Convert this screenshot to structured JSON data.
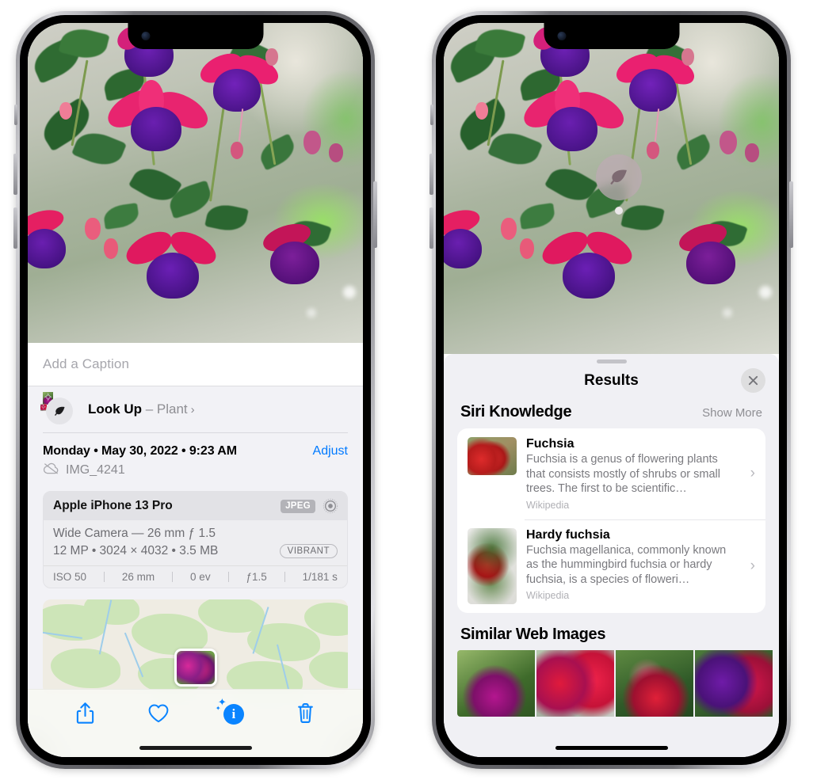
{
  "left_phone": {
    "photo": {
      "alt": "fuchsia-flowers-photo"
    },
    "caption_placeholder": "Add a Caption",
    "lookup": {
      "icon": "leaf-icon",
      "label": "Look Up",
      "dash": " – ",
      "subject": "Plant",
      "chevron": "›"
    },
    "date_line": "Monday • May 30, 2022 • 9:23 AM",
    "adjust_label": "Adjust",
    "cloud_icon": "cloud-slash-icon",
    "file_name": "IMG_4241",
    "camera_card": {
      "model": "Apple iPhone 13 Pro",
      "format_badge": "JPEG",
      "aperture_icon": "aperture-icon",
      "lens_line": "Wide Camera — 26 mm ƒ 1.5",
      "specs_line": "12 MP • 3024 × 4032 • 3.5 MB",
      "style_badge": "VIBRANT",
      "exif": [
        "ISO 50",
        "26 mm",
        "0 ev",
        "ƒ1.5",
        "1/181 s"
      ]
    },
    "map": {
      "name": "location-map"
    },
    "toolbar": [
      {
        "name": "share-button",
        "icon": "share-icon"
      },
      {
        "name": "favorite-button",
        "icon": "heart-icon"
      },
      {
        "name": "info-button",
        "icon": "info-sparkle-icon",
        "glyph": "i"
      },
      {
        "name": "delete-button",
        "icon": "trash-icon"
      }
    ]
  },
  "right_phone": {
    "photo": {
      "alt": "fuchsia-flowers-photo"
    },
    "lens_badge_icon": "leaf-icon",
    "sheet": {
      "title": "Results",
      "close_icon": "close-icon",
      "siri_knowledge": {
        "heading": "Siri Knowledge",
        "show_more": "Show More",
        "items": [
          {
            "title": "Fuchsia",
            "description": "Fuchsia is a genus of flowering plants that consists mostly of shrubs or small trees. The first to be scientific…",
            "source": "Wikipedia",
            "chevron": "›"
          },
          {
            "title": "Hardy fuchsia",
            "description": "Fuchsia magellanica, commonly known as the hummingbird fuchsia or hardy fuchsia, is a species of floweri…",
            "source": "Wikipedia",
            "chevron": "›"
          }
        ]
      },
      "similar_web_images": {
        "heading": "Similar Web Images",
        "items": [
          {
            "name": "similar-image-1"
          },
          {
            "name": "similar-image-2"
          },
          {
            "name": "similar-image-3"
          },
          {
            "name": "similar-image-4"
          }
        ]
      }
    }
  },
  "colors": {
    "accent_blue": "#007aff",
    "sheet_bg": "#f0f0f4",
    "info_bg": "#f2f2f6",
    "secondary_text": "#8e8e93"
  }
}
